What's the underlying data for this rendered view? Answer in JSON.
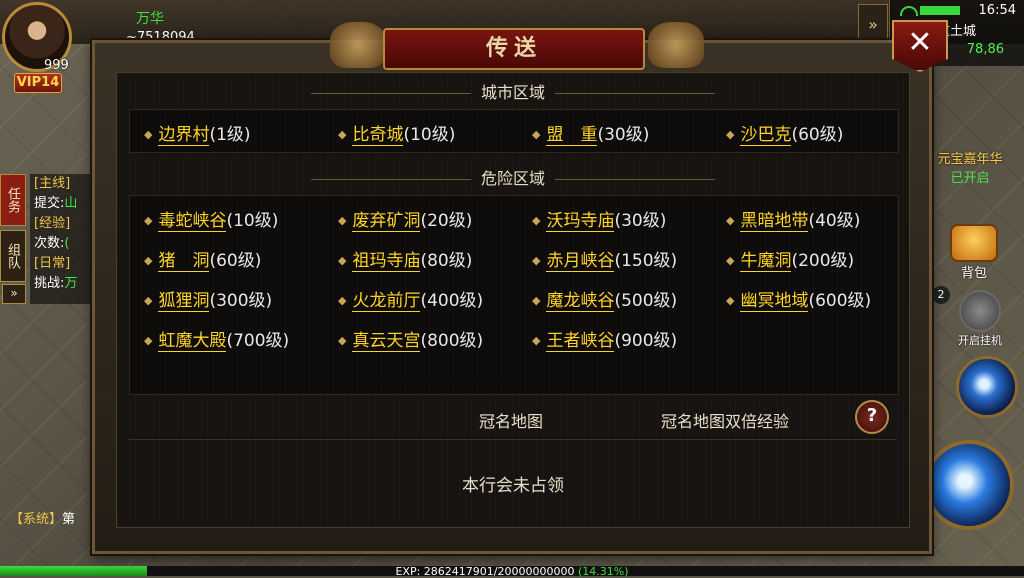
{
  "hud": {
    "player_level": "999",
    "vip": "VIP14",
    "player_name": "万华",
    "player_power": "~7518094",
    "time": "16:54",
    "map_name": "盟重土城",
    "coords": "78,86",
    "expand_icon": "double-chevron-right-icon"
  },
  "quest_tabs": [
    "任务",
    "组队"
  ],
  "quests": [
    {
      "tag": "[主线]",
      "text": "提交:",
      "extra": "山"
    },
    {
      "tag": "[经验]",
      "text": "次数:",
      "extra": "("
    },
    {
      "tag": "[日常]",
      "text": "挑战:",
      "extra": "万"
    }
  ],
  "system_msg": {
    "tag": "【系统】",
    "text": "第"
  },
  "right_panel": {
    "event_title": "元宝嘉年华",
    "event_status": "已开启",
    "bag_label": "背包",
    "auto_label": "开启挂机",
    "auto_badge": "2"
  },
  "exp": {
    "text": "EXP: 2862417901/20000000000",
    "percent_text": "(14.31%)",
    "fraction": 0.1431
  },
  "dialog": {
    "title": "传送",
    "close_icon": "close-icon",
    "city_section_title": "城市区域",
    "city_locations": [
      {
        "name": "边界村",
        "level": "(1级)"
      },
      {
        "name": "比奇城",
        "level": "(10级)"
      },
      {
        "name": "盟　重",
        "level": "(30级)"
      },
      {
        "name": "沙巴克",
        "level": "(60级)"
      }
    ],
    "danger_section_title": "危险区域",
    "danger_locations": [
      {
        "name": "毒蛇峡谷",
        "level": "(10级)"
      },
      {
        "name": "废弃矿洞",
        "level": "(20级)"
      },
      {
        "name": "沃玛寺庙",
        "level": "(30级)"
      },
      {
        "name": "黑暗地带",
        "level": "(40级)"
      },
      {
        "name": "猪　洞",
        "level": "(60级)"
      },
      {
        "name": "祖玛寺庙",
        "level": "(80级)"
      },
      {
        "name": "赤月峡谷",
        "level": "(150级)"
      },
      {
        "name": "牛魔洞",
        "level": "(200级)"
      },
      {
        "name": "狐狸洞",
        "level": "(300级)"
      },
      {
        "name": "火龙前厅",
        "level": "(400级)"
      },
      {
        "name": "魔龙峡谷",
        "level": "(500级)"
      },
      {
        "name": "幽冥地域",
        "level": "(600级)"
      },
      {
        "name": "虹魔大殿",
        "level": "(700级)"
      },
      {
        "name": "真云天宫",
        "level": "(800级)"
      },
      {
        "name": "王者峡谷",
        "level": "(900级)"
      }
    ],
    "crown_map_label": "冠名地图",
    "crown_double_exp_label": "冠名地图双倍经验",
    "help_icon": "question-icon",
    "guild_status": "本行会未占领"
  }
}
